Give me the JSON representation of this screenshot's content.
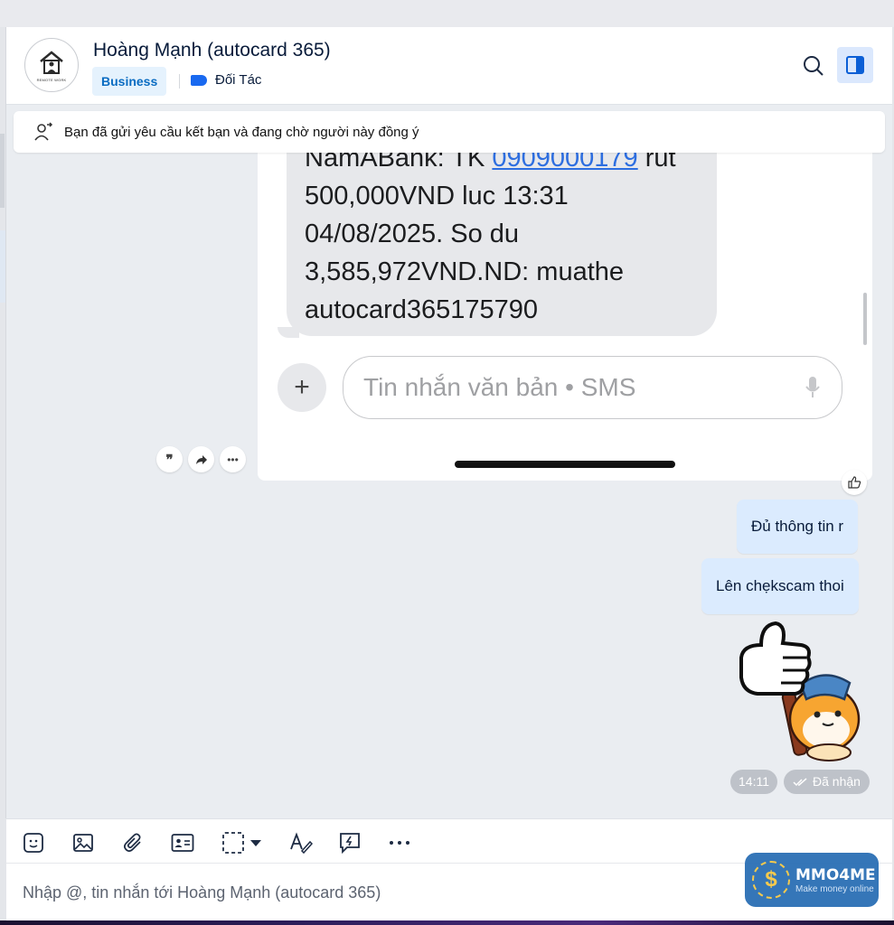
{
  "header": {
    "title": "Hoàng Mạnh (autocard 365)",
    "badge": "Business",
    "tag_label": "Đối Tác",
    "avatar_caption": "REMOTE WORK"
  },
  "notice": {
    "text": "Bạn đã gửi yêu cầu kết bạn và đang chờ người này đồng ý"
  },
  "screenshot": {
    "sms_line1_prefix": "NamABank: TK ",
    "sms_account": "0909000179",
    "sms_line1_suffix": " rut",
    "sms_body": "500,000VND luc 13:31\n04/08/2025. So du\n3,585,972VND.ND: muathe\nautocard365175790",
    "sms_input_placeholder": "Tin nhắn văn bản • SMS"
  },
  "messages": [
    {
      "text": "Đủ thông tin r"
    },
    {
      "text": "Lên chẹkscam thoi"
    }
  ],
  "meta": {
    "time": "14:11",
    "status": "Đã nhận"
  },
  "composer": {
    "placeholder": "Nhập @, tin nhắn tới Hoàng Mạnh (autocard 365)"
  },
  "watermark": {
    "name": "MMO4ME",
    "tagline": "Make money online"
  },
  "colors": {
    "accent": "#0a6cc2",
    "my_bubble": "#dbebfe",
    "chat_bg": "#eaedf1",
    "tag": "#1969f0"
  },
  "icons": [
    "search-icon",
    "sidebar-toggle-icon",
    "add-friend-icon",
    "quote-icon",
    "share-icon",
    "more-icon",
    "like-icon",
    "sticker-icon",
    "image-icon",
    "attachment-icon",
    "contact-card-icon",
    "screenshot-icon",
    "dropdown-icon",
    "format-text-icon",
    "quick-message-icon",
    "more-options-icon"
  ]
}
